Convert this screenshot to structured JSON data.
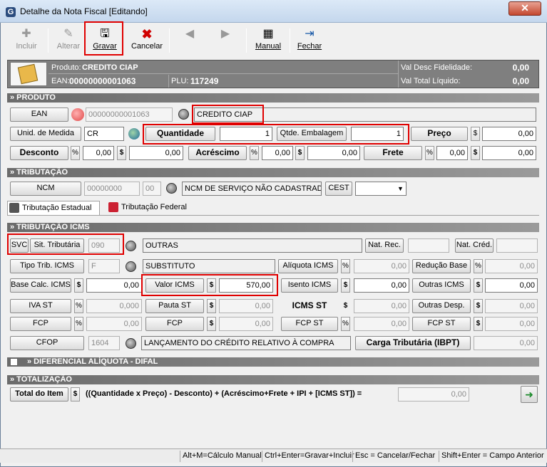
{
  "window": {
    "title": "Detalhe da Nota Fiscal [Editando]",
    "app_icon": "G",
    "close": "✕"
  },
  "toolbar": {
    "incluir": "Incluir",
    "alterar": "Alterar",
    "gravar": "Gravar",
    "cancelar": "Cancelar",
    "manual": "Manual",
    "fechar": "Fechar"
  },
  "product_header": {
    "produto_label": "Produto:",
    "produto_value": "CREDITO CIAP",
    "ean_label": "EAN:",
    "ean_value": "00000000001063",
    "plu_label": "PLU:",
    "plu_value": "117249",
    "desc_fid_label": "Val Desc Fidelidade:",
    "desc_fid_value": "0,00",
    "total_liq_label": "Val Total Líquido:",
    "total_liq_value": "0,00"
  },
  "sections": {
    "produto": "» PRODUTO",
    "tributacao": "» TRIBUTAÇÃO",
    "trib_icms": "» TRIBUTAÇÃO ICMS",
    "difal": "» DIFERENCIAL ALÍQUOTA - DIFAL",
    "totalizacao": "» TOTALIZAÇÃO"
  },
  "produto": {
    "ean_btn": "EAN",
    "ean_value": "00000000001063",
    "descricao": "CREDITO CIAP",
    "unid_btn": "Unid. de Medida",
    "unid_value": "CR",
    "quantidade_btn": "Quantidade",
    "quantidade_value": "1",
    "qtde_emb_btn": "Qtde. Embalagem",
    "qtde_emb_value": "1",
    "preco_btn": "Preço",
    "preco_value": "0,00",
    "desconto_btn": "Desconto",
    "desc_pct": "0,00",
    "desc_val": "0,00",
    "acrescimo_btn": "Acréscimo",
    "acr_pct": "0,00",
    "acr_val": "0,00",
    "frete_btn": "Frete",
    "frete_pct": "0,00",
    "frete_val": "0,00"
  },
  "tributacao": {
    "ncm_btn": "NCM",
    "ncm_value": "00000000",
    "ncm_ext": "00",
    "ncm_desc": "NCM DE SERVIÇO NÃO CADASTRAD",
    "cest_btn": "CEST",
    "cest_value": ""
  },
  "tabs": {
    "estadual": "Tributação Estadual",
    "federal": "Tributação Federal"
  },
  "icms": {
    "svc": "SVC",
    "sit_trib_btn": "Sit. Tributária",
    "sit_trib_value": "090",
    "sit_trib_desc": "OUTRAS",
    "nat_rec_btn": "Nat. Rec.",
    "nat_rec_value": "",
    "nat_cred_btn": "Nat. Créd.",
    "nat_cred_value": "",
    "tipo_trib_btn": "Tipo Trib. ICMS",
    "tipo_trib_value": "F",
    "tipo_trib_desc": "SUBSTITUTO",
    "aliq_icms_btn": "Alíquota ICMS",
    "aliq_icms_value": "0,00",
    "red_base_btn": "Redução Base",
    "red_base_value": "0,00",
    "base_calc_btn": "Base Calc. ICMS",
    "base_calc_value": "0,00",
    "valor_icms_btn": "Valor ICMS",
    "valor_icms_value": "570,00",
    "isento_btn": "Isento ICMS",
    "isento_value": "0,00",
    "outras_icms_btn": "Outras ICMS",
    "outras_icms_value": "0,00",
    "iva_st_btn": "IVA ST",
    "iva_st_value": "0,000",
    "pauta_st_btn": "Pauta ST",
    "pauta_st_value": "0,00",
    "icms_st_btn": "ICMS ST",
    "icms_st_value": "0,00",
    "outras_desp_btn": "Outras Desp.",
    "outras_desp_value": "0,00",
    "fcp_btn": "FCP",
    "fcp_pct": "0,00",
    "fcp2_btn": "FCP",
    "fcp2_value": "0,00",
    "fcp_st_btn": "FCP ST",
    "fcp_st_pct": "0,00",
    "fcp_st2_btn": "FCP ST",
    "fcp_st2_value": "0,00",
    "cfop_btn": "CFOP",
    "cfop_value": "1604",
    "cfop_desc": "LANÇAMENTO DO CRÉDITO RELATIVO À COMPRA",
    "carga_btn": "Carga Tributária (IBPT)",
    "carga_value": "0,00"
  },
  "total": {
    "label": "Total do Item",
    "currency": "$",
    "formula": "((Quantidade x Preço) - Desconto) + (Acréscimo+Frete + IPI + [ICMS ST]) =",
    "value": "0,00"
  },
  "status": [
    "Alt+M=Cálculo Manual",
    "Ctrl+Enter=Gravar+Incluir",
    "Esc = Cancelar/Fechar",
    "Shift+Enter = Campo Anterior"
  ],
  "symbols": {
    "pct": "%",
    "cur": "$"
  }
}
